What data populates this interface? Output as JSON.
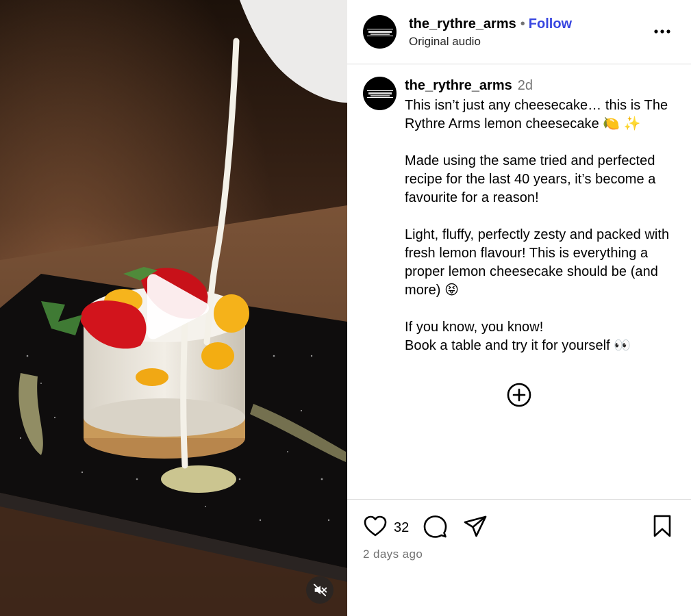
{
  "post": {
    "username": "the_rythre_arms",
    "follow_label": "Follow",
    "audio_label": "Original audio",
    "age_short": "2d",
    "caption": "This isn’t just any cheesecake… this is The Rythre Arms lemon cheesecake 🍋 ✨\n\nMade using the same tried and perfected recipe for the last 40 years, it’s become a favourite for a reason!\n\nLight, fluffy, perfectly zesty and packed with fresh lemon flavour! This is everything a proper lemon cheesecake should be (and more) 😝\n\nIf you know, you know!\nBook a table and try it for yourself 👀",
    "like_count": "32",
    "date_label": "2 days ago"
  },
  "icons": {
    "more": "more-options-icon",
    "play": "play-icon",
    "mute": "muted-speaker-icon",
    "add": "plus-circle-icon",
    "like": "heart-icon",
    "comment": "comment-bubble-icon",
    "share": "paper-plane-icon",
    "save": "bookmark-icon"
  },
  "colors": {
    "follow": "#3846e0",
    "secondary_text": "#737373",
    "divider": "#dbdbdb"
  }
}
